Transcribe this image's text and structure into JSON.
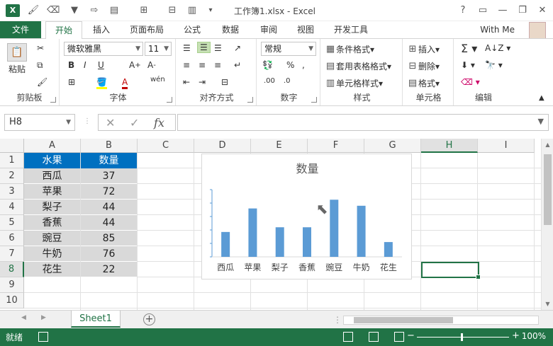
{
  "window": {
    "title": "工作簿1.xlsx - Excel",
    "app_logo": "X"
  },
  "tabs": {
    "file": "文件",
    "items": [
      "开始",
      "插入",
      "页面布局",
      "公式",
      "数据",
      "审阅",
      "视图",
      "开发工具"
    ],
    "active": "开始",
    "user": "With Me"
  },
  "ribbon": {
    "clipboard": {
      "label": "剪贴板",
      "paste": "粘贴"
    },
    "font": {
      "label": "字体",
      "name": "微软雅黑",
      "size": "11"
    },
    "alignment": {
      "label": "对齐方式"
    },
    "number": {
      "label": "数字",
      "format": "常规"
    },
    "styles": {
      "label": "样式",
      "conditional": "条件格式",
      "table": "套用表格格式",
      "cell": "单元格样式"
    },
    "cells": {
      "label": "单元格",
      "insert": "插入",
      "delete": "删除",
      "format": "格式"
    },
    "editing": {
      "label": "编辑"
    }
  },
  "formula_bar": {
    "name_box": "H8",
    "fx": "fx",
    "value": ""
  },
  "sheet": {
    "columns": [
      "A",
      "B",
      "C",
      "D",
      "E",
      "F",
      "G",
      "H",
      "I"
    ],
    "rows": [
      "1",
      "2",
      "3",
      "4",
      "5",
      "6",
      "7",
      "8",
      "9",
      "10"
    ],
    "selected_column": "H",
    "selected_row": "8",
    "header": [
      "水果",
      "数量"
    ],
    "data": [
      [
        "西瓜",
        "37"
      ],
      [
        "苹果",
        "72"
      ],
      [
        "梨子",
        "44"
      ],
      [
        "香蕉",
        "44"
      ],
      [
        "豌豆",
        "85"
      ],
      [
        "牛奶",
        "76"
      ],
      [
        "花生",
        "22"
      ]
    ]
  },
  "chart_data": {
    "type": "bar",
    "title": "数量",
    "categories": [
      "西瓜",
      "苹果",
      "梨子",
      "香蕉",
      "豌豆",
      "牛奶",
      "花生"
    ],
    "values": [
      37,
      72,
      44,
      44,
      85,
      76,
      22
    ],
    "ylim": [
      0,
      100
    ],
    "color": "#5b9bd5",
    "grid": false,
    "legend": "none"
  },
  "sheet_tabs": {
    "active": "Sheet1",
    "add": "+"
  },
  "status": {
    "ready": "就绪",
    "zoom": "100%"
  },
  "colors": {
    "brand": "#217346",
    "header_fill": "#0070c0",
    "body_fill": "#d9d9d9"
  }
}
